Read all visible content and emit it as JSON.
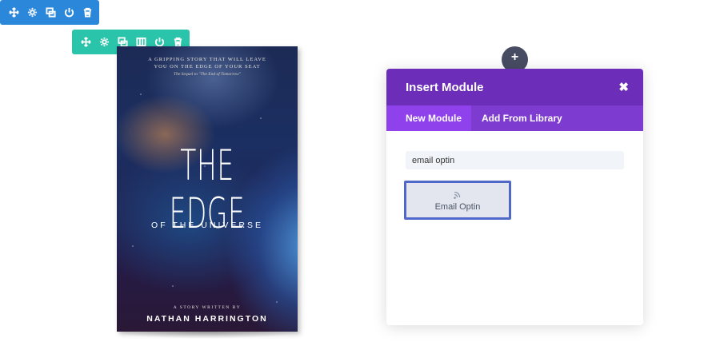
{
  "section_toolbar": {
    "color": "#2b87da",
    "icons": [
      "move-icon",
      "gear-icon",
      "duplicate-icon",
      "power-icon",
      "trash-icon"
    ]
  },
  "row_toolbar": {
    "color": "#29c4a9",
    "icons": [
      "move-icon",
      "gear-icon",
      "duplicate-icon",
      "columns-icon",
      "power-icon",
      "trash-icon"
    ]
  },
  "book": {
    "tagline_line1": "A GRIPPING STORY THAT WILL LEAVE",
    "tagline_line2": "YOU ON THE EDGE OF YOUR SEAT",
    "sequel": "The Sequel to \"The End of Tomorrow\"",
    "title": "THE EDGE",
    "subtitle": "OF THE UNIVERSE",
    "written_by": "A STORY WRITTEN BY",
    "author": "NATHAN HARRINGTON"
  },
  "add_button": {
    "symbol": "+"
  },
  "modal": {
    "title": "Insert Module",
    "close_symbol": "✖",
    "tabs": [
      {
        "label": "New Module",
        "active": true
      },
      {
        "label": "Add From Library",
        "active": false
      }
    ],
    "search_value": "email optin",
    "results": [
      {
        "label": "Email Optin",
        "icon": "rss-icon"
      }
    ],
    "header_color": "#6c2eb9",
    "tabs_color": "#7e3bd0",
    "active_tab_color": "#8f42ec",
    "highlight_color": "#4f68c9"
  }
}
